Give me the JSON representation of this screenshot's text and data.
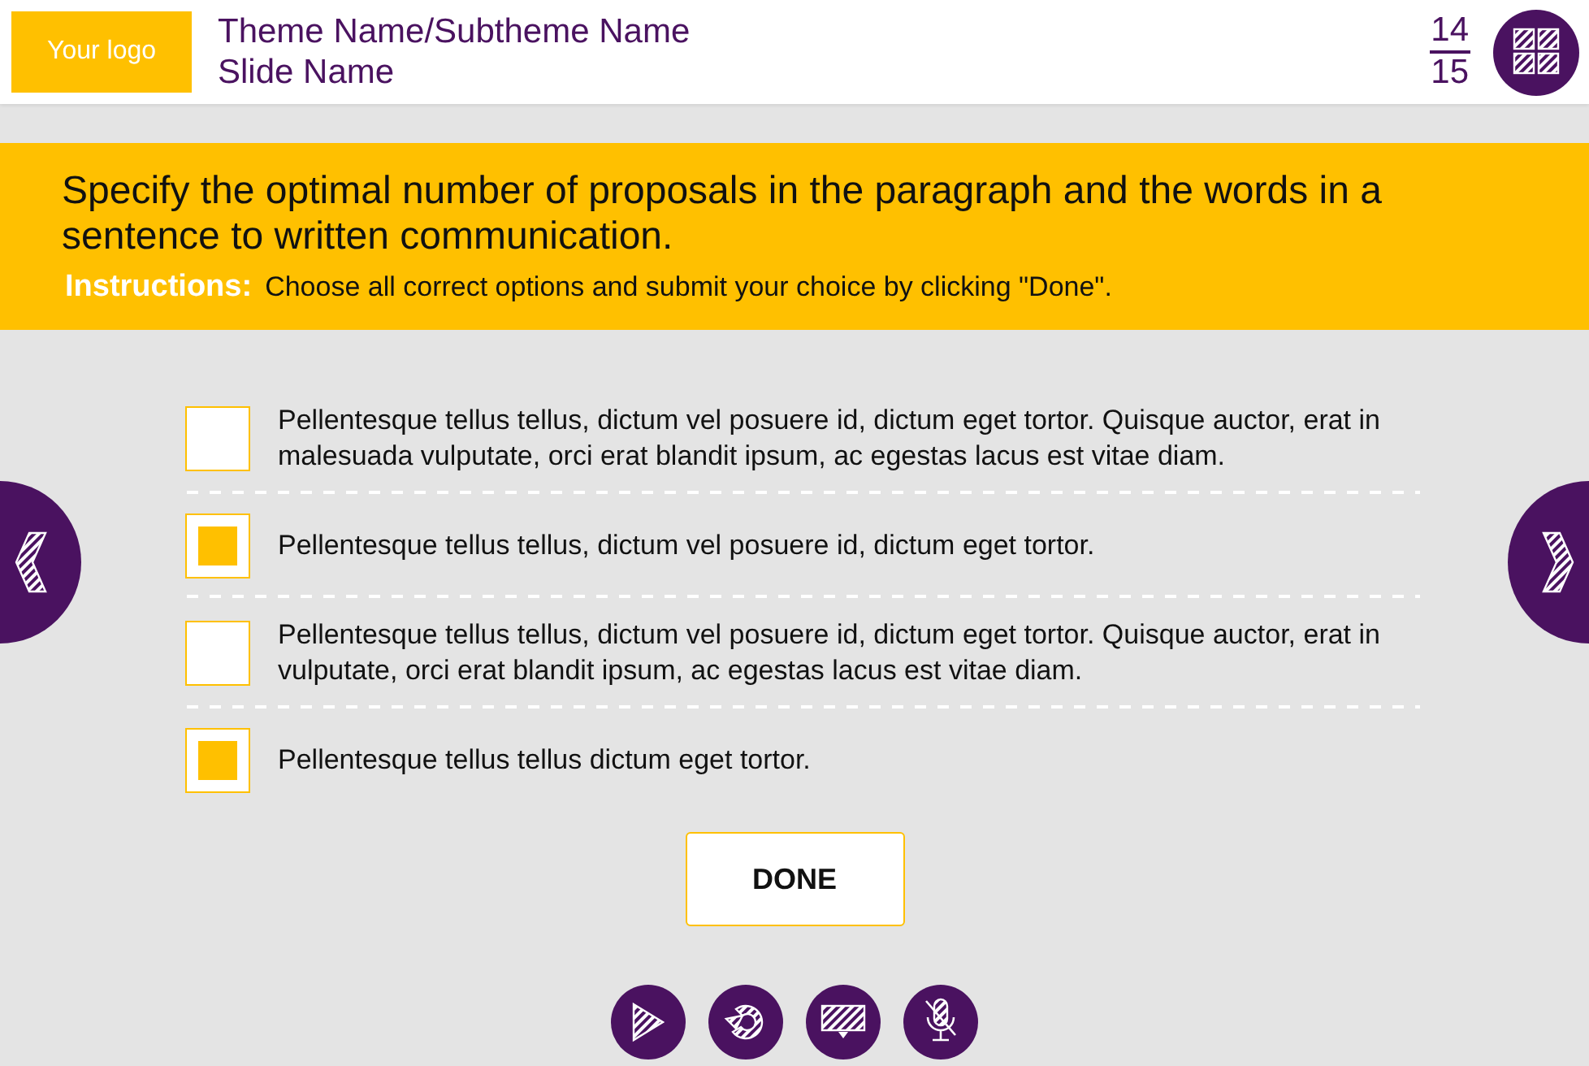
{
  "header": {
    "logo": "Your logo",
    "theme": "Theme Name/Subtheme Name",
    "slide": "Slide Name",
    "page_current": "14",
    "page_total": "15"
  },
  "question": {
    "text": "Specify the optimal number of proposals in the paragraph and the words in a sentence to written communication.",
    "instructions_label": "Instructions:",
    "instructions": "Choose all correct options and submit your choice by clicking \"Done\"."
  },
  "options": [
    {
      "text": "Pellentesque tellus tellus, dictum vel posuere id, dictum eget tortor. Quisque auctor, erat in malesuada vulputate, orci erat blandit ipsum, ac egestas lacus est vitae diam.",
      "checked": false
    },
    {
      "text": "Pellentesque tellus tellus, dictum vel posuere id, dictum eget tortor.",
      "checked": true
    },
    {
      "text": "Pellentesque tellus tellus, dictum vel posuere id, dictum eget tortor. Quisque auctor, erat in vulputate, orci erat blandit ipsum, ac egestas lacus est vitae diam.",
      "checked": false
    },
    {
      "text": "Pellentesque tellus tellus dictum eget tortor.",
      "checked": true
    }
  ],
  "done_button": "DONE"
}
